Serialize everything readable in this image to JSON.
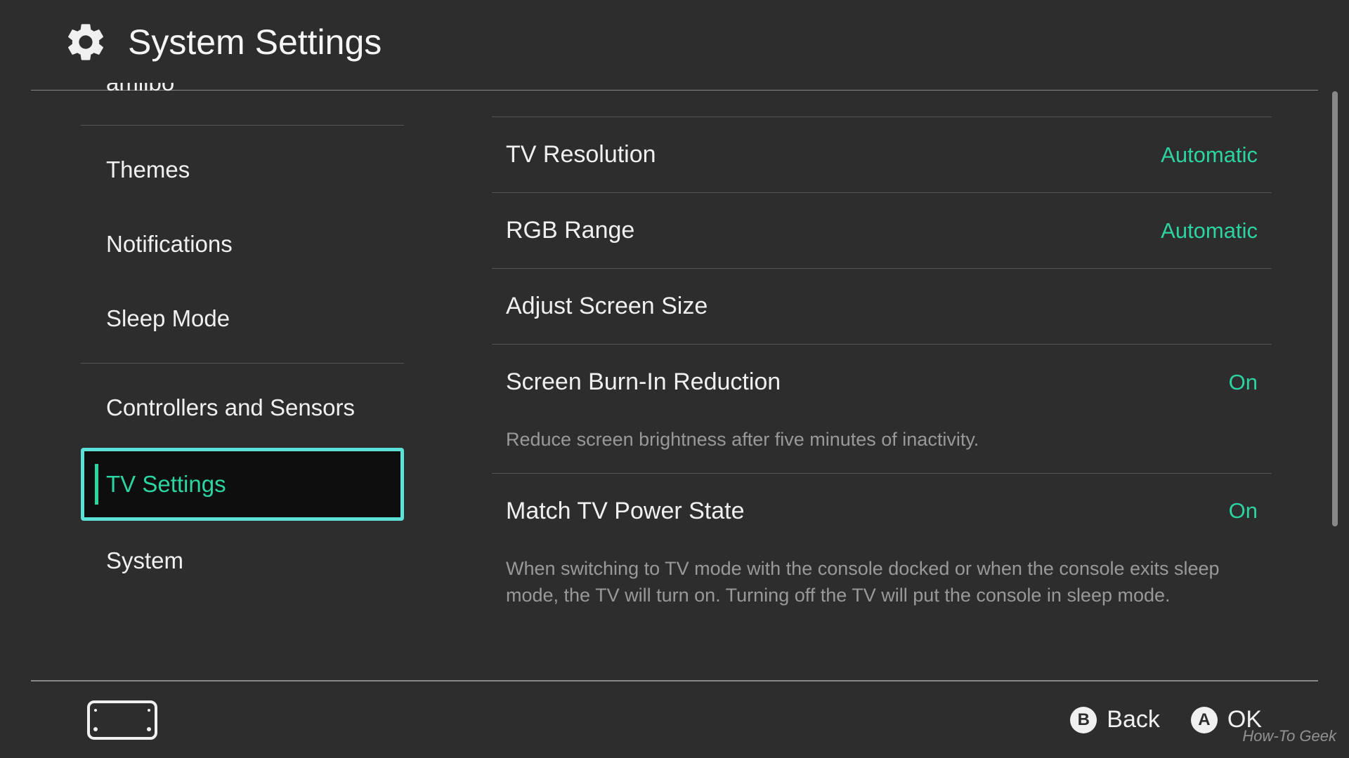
{
  "header": {
    "title": "System Settings"
  },
  "sidebar": {
    "items": [
      {
        "label": "amiibo",
        "cutoff": true
      },
      {
        "label": "Themes"
      },
      {
        "label": "Notifications"
      },
      {
        "label": "Sleep Mode"
      },
      {
        "label": "Controllers and Sensors",
        "divider_before": true
      },
      {
        "label": "TV Settings",
        "selected": true
      },
      {
        "label": "System"
      }
    ]
  },
  "main": {
    "settings": [
      {
        "label": "TV Resolution",
        "value": "Automatic"
      },
      {
        "label": "RGB Range",
        "value": "Automatic"
      },
      {
        "label": "Adjust Screen Size",
        "value": ""
      },
      {
        "label": "Screen Burn-In Reduction",
        "value": "On",
        "description": "Reduce screen brightness after five minutes of inactivity."
      },
      {
        "label": "Match TV Power State",
        "value": "On",
        "description": "When switching to TV mode with the console docked or when the console exits sleep mode, the TV will turn on. Turning off the TV will put the console in sleep mode."
      }
    ]
  },
  "footer": {
    "back_button": "B",
    "back_label": "Back",
    "ok_button": "A",
    "ok_label": "OK"
  },
  "watermark": "How-To Geek"
}
